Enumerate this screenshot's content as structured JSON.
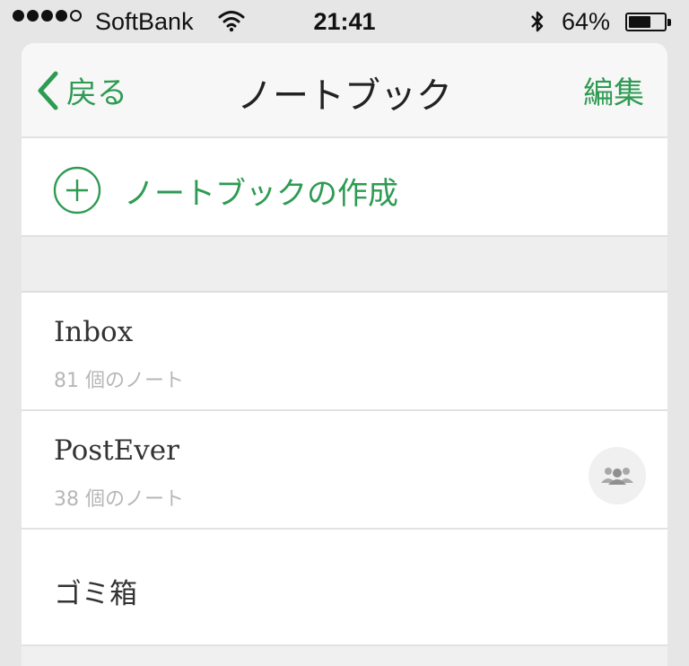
{
  "status_bar": {
    "carrier": "SoftBank",
    "time": "21:41",
    "battery_percent": "64%",
    "battery_level": 0.64,
    "signal_bars_filled": 4,
    "signal_bars_total": 5,
    "icons": [
      "signal-dots-icon",
      "wifi-icon",
      "bluetooth-icon",
      "battery-icon"
    ]
  },
  "nav": {
    "back_label": "戻る",
    "title": "ノートブック",
    "edit_label": "編集"
  },
  "create": {
    "label": "ノートブックの作成"
  },
  "notebooks": [
    {
      "name": "Inbox",
      "count": "81 個のノート",
      "shared": false
    },
    {
      "name": "PostEver",
      "count": "38 個のノート",
      "shared": true
    },
    {
      "name": "ゴミ箱",
      "count": "",
      "shared": false
    }
  ],
  "colors": {
    "accent": "#2e9b53",
    "background": "#e6e6e6",
    "row": "#ffffff",
    "secondary_text": "#b7b7b7"
  }
}
